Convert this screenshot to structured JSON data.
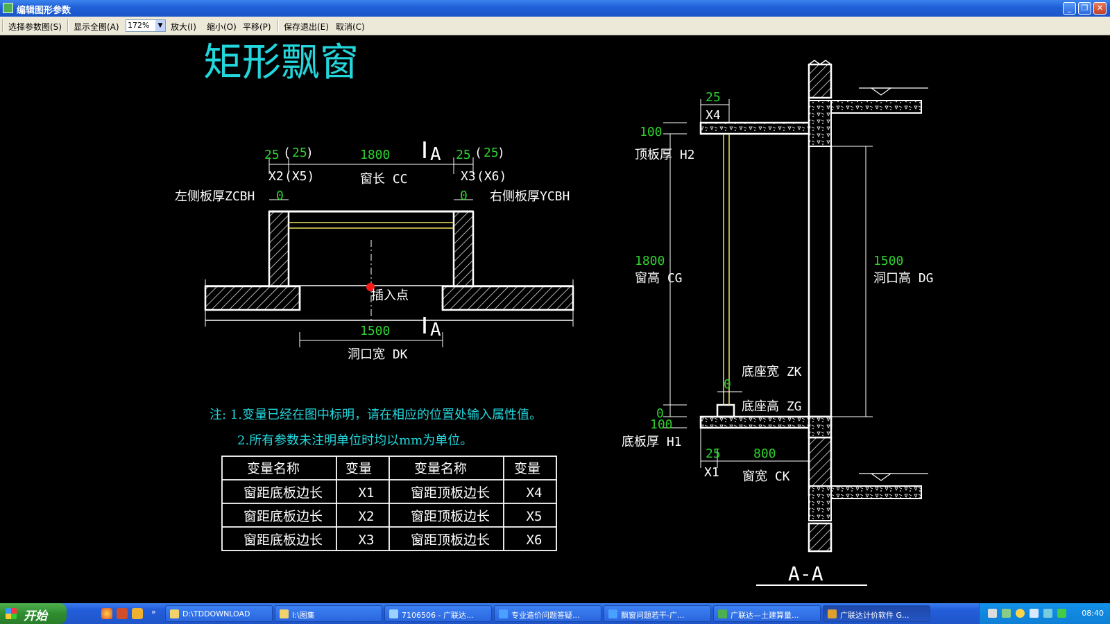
{
  "window": {
    "title": "编辑图形参数"
  },
  "toolbar": {
    "select_label": "选择参数图(S)",
    "show_all_label": "显示全图(A)",
    "zoom_value": "172%",
    "zoom_in_label": "放大(I)",
    "zoom_out_label": "缩小(O)",
    "pan_label": "平移(P)",
    "save_exit_label": "保存退出(E)",
    "cancel_label": "取消(C)"
  },
  "drawing": {
    "title": "矩形飘窗",
    "plan": {
      "x2_val": "25",
      "x5_val": "25",
      "window_length_val": "1800",
      "x3_val": "25",
      "x6_val": "25",
      "x2_label": "X2",
      "x5_label": "(X5)",
      "window_length_label": "窗长 CC",
      "x3_label": "X3",
      "x6_label": "(X6)",
      "left_thickness_label": "左侧板厚ZCBH",
      "left_thickness_val": "0",
      "right_thickness_label": "右侧板厚YCBH",
      "right_thickness_val": "0",
      "insert_point_label": "插入点",
      "opening_width_val": "1500",
      "opening_width_label": "洞口宽 DK",
      "section_mark": "A"
    },
    "notes": {
      "line1": "注: 1.变量已经在图中标明，请在相应的位置处输入属性值。",
      "line2": "2.所有参数未注明单位时均以mm为单位。"
    },
    "table": {
      "headers": [
        "变量名称",
        "变量",
        "变量名称",
        "变量"
      ],
      "rows": [
        [
          "窗距底板边长",
          "X1",
          "窗距顶板边长",
          "X4"
        ],
        [
          "窗距底板边长",
          "X2",
          "窗距顶板边长",
          "X5"
        ],
        [
          "窗距底板边长",
          "X3",
          "窗距顶板边长",
          "X6"
        ]
      ]
    },
    "section": {
      "x4_val": "25",
      "x4_label": "X4",
      "top_thickness_val": "100",
      "top_thickness_label": "顶板厚 H2",
      "window_height_val": "1800",
      "window_height_label": "窗高 CG",
      "opening_height_val": "1500",
      "opening_height_label": "洞口高 DG",
      "base_width_val": "0",
      "base_width_label": "底座宽 ZK",
      "base_height_val": "0",
      "base_height_label": "底座高 ZG",
      "bottom_thickness_val": "100",
      "bottom_thickness_label": "底板厚 H1",
      "x1_val": "25",
      "x1_label": "X1",
      "window_width_val": "800",
      "window_width_label": "窗宽 CK",
      "section_title": "A-A"
    }
  },
  "taskbar": {
    "start_label": "开始",
    "tasks": [
      "D:\\TDDOWNLOAD",
      "I:\\图集",
      "7106506 - 广联达...",
      "专业造价问题答疑...",
      "飘窗问题若干-广...",
      "广联达—土建算量...",
      "广联达计价软件 G..."
    ],
    "clock": "08:40"
  },
  "colors": {
    "dimension": "#2fd12f",
    "title": "#22d6dc",
    "insert_point": "#ff1a1a",
    "glass": "#f0e060"
  }
}
